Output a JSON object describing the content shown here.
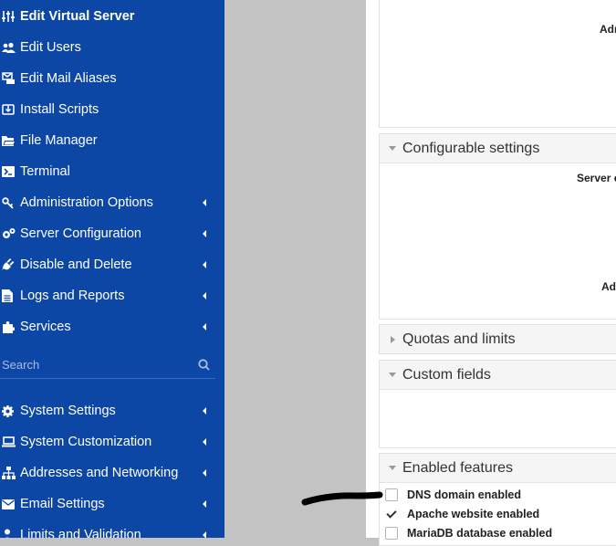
{
  "sidebar": {
    "items": [
      {
        "label": "Edit Virtual Server",
        "icon": "sliders-icon",
        "active": true,
        "submenu": false
      },
      {
        "label": "Edit Users",
        "icon": "users-icon",
        "active": false,
        "submenu": false
      },
      {
        "label": "Edit Mail Aliases",
        "icon": "mail-alias-icon",
        "active": false,
        "submenu": false
      },
      {
        "label": "Install Scripts",
        "icon": "install-icon",
        "active": false,
        "submenu": false
      },
      {
        "label": "File Manager",
        "icon": "folder-icon",
        "active": false,
        "submenu": false
      },
      {
        "label": "Terminal",
        "icon": "terminal-icon",
        "active": false,
        "submenu": false
      },
      {
        "label": "Administration Options",
        "icon": "key-icon",
        "active": false,
        "submenu": true
      },
      {
        "label": "Server Configuration",
        "icon": "gears-icon",
        "active": false,
        "submenu": true
      },
      {
        "label": "Disable and Delete",
        "icon": "plug-icon",
        "active": false,
        "submenu": true
      },
      {
        "label": "Logs and Reports",
        "icon": "document-icon",
        "active": false,
        "submenu": true
      },
      {
        "label": "Services",
        "icon": "puzzle-icon",
        "active": false,
        "submenu": true
      },
      {
        "label": "System Settings",
        "icon": "gear-icon",
        "active": false,
        "submenu": true
      },
      {
        "label": "System Customization",
        "icon": "laptop-icon",
        "active": false,
        "submenu": true
      },
      {
        "label": "Addresses and Networking",
        "icon": "network-icon",
        "active": false,
        "submenu": true
      },
      {
        "label": "Email Settings",
        "icon": "envelope-icon",
        "active": false,
        "submenu": true
      },
      {
        "label": "Limits and Validation",
        "icon": "person-icon",
        "active": false,
        "submenu": true
      }
    ],
    "search_placeholder": "Search"
  },
  "content": {
    "panel_top": {
      "label": "Adr"
    },
    "configurable": {
      "title": "Configurable settings",
      "label_server": "Server c",
      "label_ad": "Ad"
    },
    "quotas": {
      "title": "Quotas and limits"
    },
    "custom_fields": {
      "title": "Custom fields"
    },
    "enabled_features": {
      "title": "Enabled features",
      "items": [
        {
          "label": "DNS domain enabled",
          "checked": false
        },
        {
          "label": "Apache website enabled",
          "checked": true
        },
        {
          "label": "MariaDB database enabled",
          "checked": false
        }
      ]
    }
  },
  "colors": {
    "sidebar": "#0d47a6",
    "gap": "#c3c3c3",
    "panel_header": "#f5f5f5"
  }
}
